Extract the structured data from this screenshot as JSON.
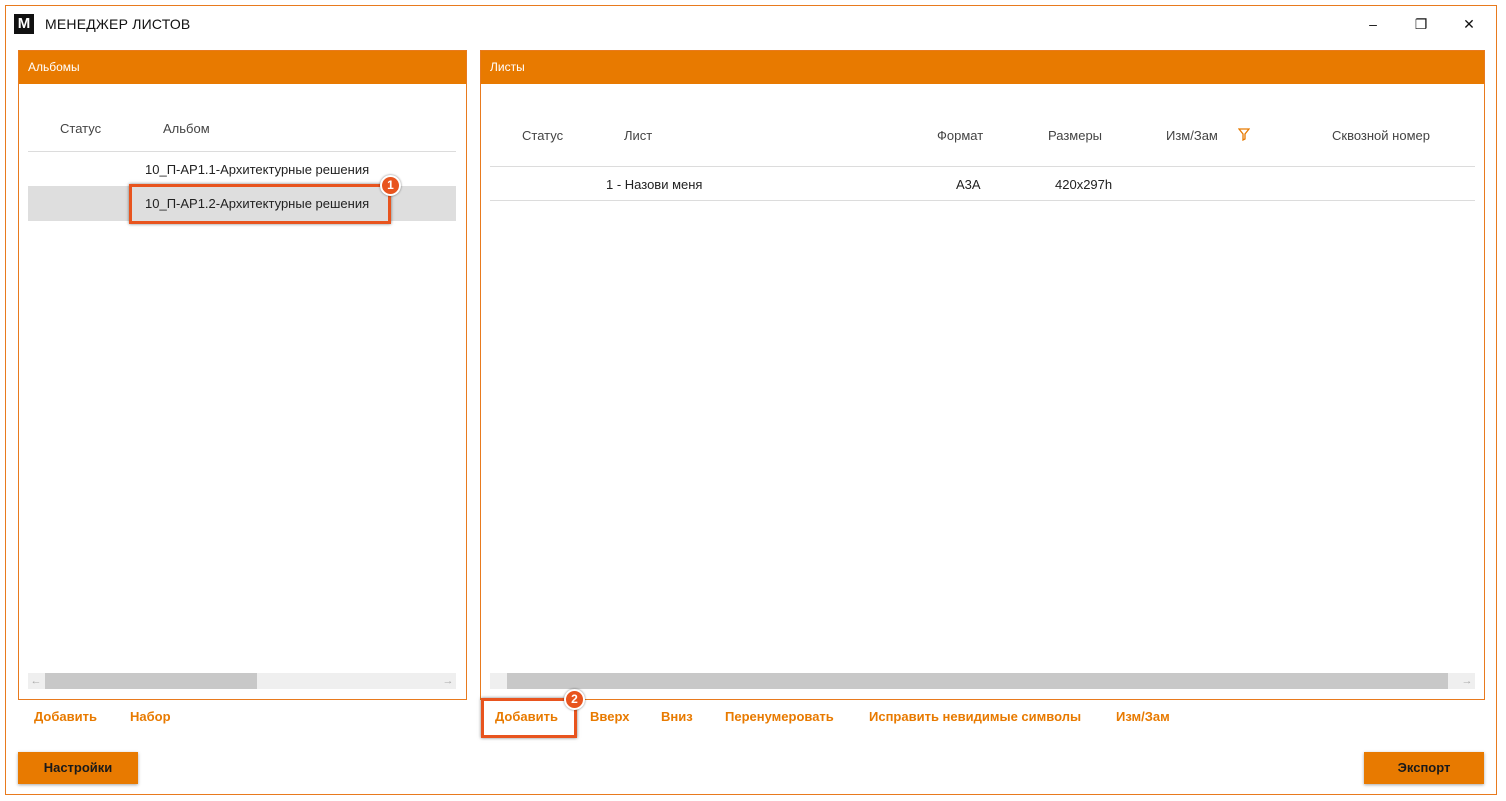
{
  "window": {
    "logo": "M",
    "title": "МЕНЕДЖЕР ЛИСТОВ",
    "controls": {
      "minimize": "–",
      "restore": "❐",
      "close": "✕"
    }
  },
  "albums_panel": {
    "header": "Альбомы",
    "columns": [
      "Статус",
      "Альбом"
    ],
    "rows": [
      {
        "status": "",
        "album": "10_П-АР1.1-Архитектурные решения"
      },
      {
        "status": "",
        "album": "10_П-АР1.2-Архитектурные решения"
      }
    ],
    "actions": {
      "add": "Добавить",
      "set": "Набор"
    }
  },
  "sheets_panel": {
    "header": "Листы",
    "columns": [
      "Статус",
      "Лист",
      "Формат",
      "Размеры",
      "Изм/Зам",
      "Сквозной номер"
    ],
    "rows": [
      {
        "status": "",
        "sheet": "1 - Назови меня",
        "format": "А3А",
        "size": "420x297h",
        "change": "",
        "number": ""
      }
    ],
    "actions": {
      "add": "Добавить",
      "up": "Вверх",
      "down": "Вниз",
      "renumber": "Перенумеровать",
      "fix_invisible": "Исправить невидимые символы",
      "change": "Изм/Зам"
    }
  },
  "footer": {
    "settings": "Настройки",
    "export": "Экспорт"
  },
  "callouts": [
    "1",
    "2"
  ],
  "colors": {
    "accent": "#e87a00",
    "callout": "#e8541e"
  },
  "icons": {
    "filter": "filter-icon",
    "scroll_left": "arrow-left-icon",
    "scroll_right": "arrow-right-icon"
  }
}
